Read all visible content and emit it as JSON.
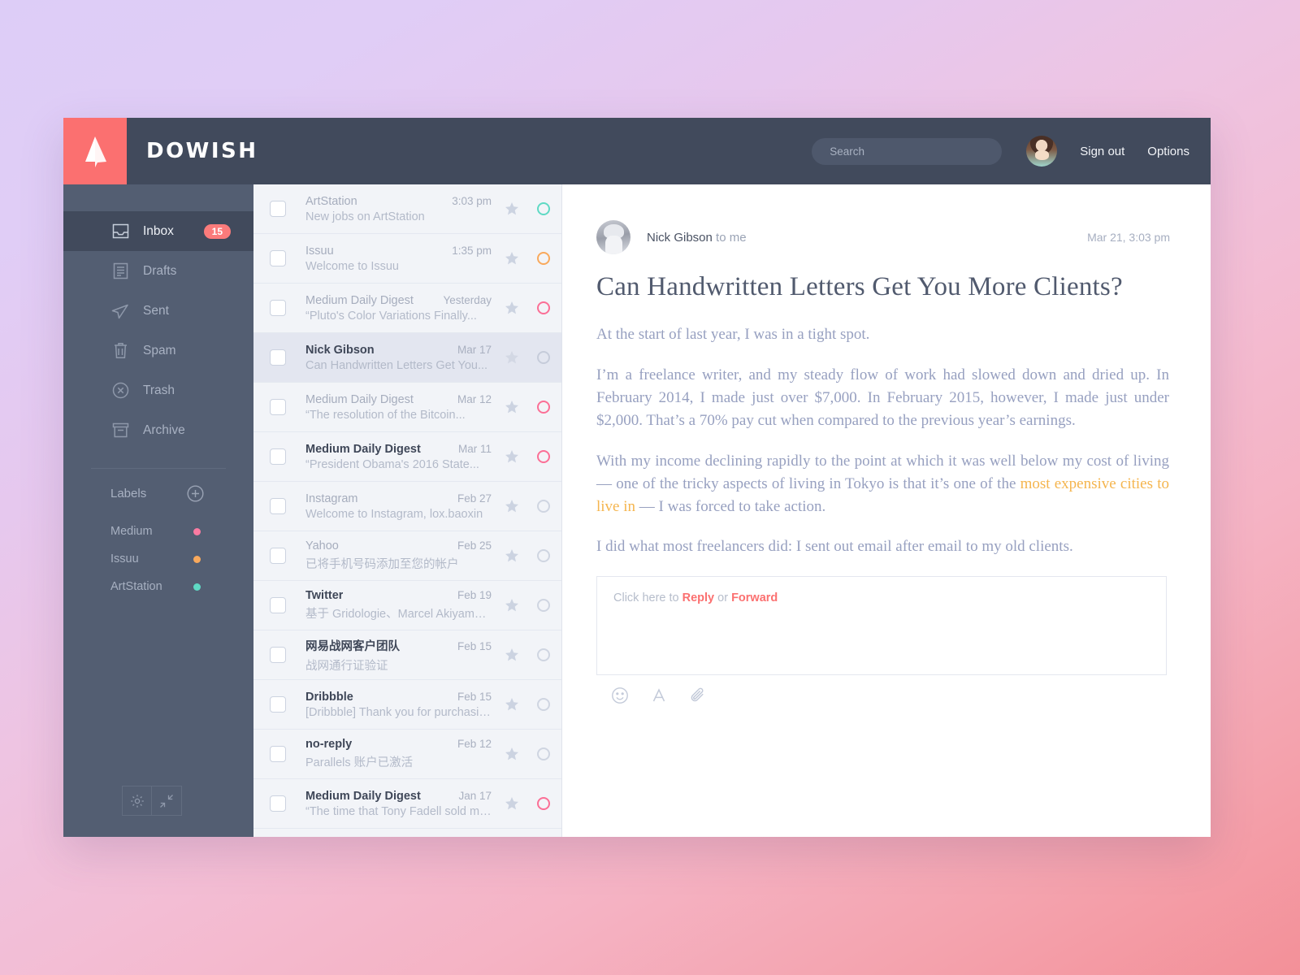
{
  "brand": {
    "name": "DOWISH",
    "logo_icon": "paper-plane-icon",
    "accent": "#fb7070"
  },
  "topbar": {
    "search_placeholder": "Search",
    "search_value": "",
    "sign_out": "Sign out",
    "options": "Options",
    "avatar_icon": "user-avatar"
  },
  "sidebar": {
    "items": [
      {
        "label": "Inbox",
        "icon": "inbox-icon",
        "badge": "15",
        "active": true
      },
      {
        "label": "Drafts",
        "icon": "drafts-icon",
        "badge": "",
        "active": false
      },
      {
        "label": "Sent",
        "icon": "sent-icon",
        "badge": "",
        "active": false
      },
      {
        "label": "Spam",
        "icon": "spam-icon",
        "badge": "",
        "active": false
      },
      {
        "label": "Trash",
        "icon": "trash-icon",
        "badge": "",
        "active": false
      },
      {
        "label": "Archive",
        "icon": "archive-icon",
        "badge": "",
        "active": false
      }
    ],
    "labels_title": "Labels",
    "add_label_icon": "plus-circle-icon",
    "labels": [
      {
        "name": "Medium",
        "color": "#fb7ba2"
      },
      {
        "name": "Issuu",
        "color": "#f9a95c"
      },
      {
        "name": "ArtStation",
        "color": "#5fd9c4"
      }
    ],
    "settings_icon": "gear-icon",
    "collapse_icon": "collapse-icon"
  },
  "maillist": [
    {
      "from": "ArtStation",
      "subject": "New jobs on ArtStation",
      "date": "3:03 pm",
      "dot": "#5fd9c4",
      "bold": false,
      "selected": false
    },
    {
      "from": "Issuu",
      "subject": "Welcome to Issuu",
      "date": "1:35 pm",
      "dot": "#f9a95c",
      "bold": false,
      "selected": false
    },
    {
      "from": "Medium Daily Digest",
      "subject": "“Pluto's Color Variations Finally...",
      "date": "Yesterday",
      "dot": "#fb6f96",
      "bold": false,
      "selected": false
    },
    {
      "from": "Nick Gibson",
      "subject": "Can Handwritten Letters Get You...",
      "date": "Mar 17",
      "dot": "#cfd5e1",
      "bold": true,
      "selected": true
    },
    {
      "from": "Medium Daily Digest",
      "subject": "“The resolution of the Bitcoin...",
      "date": "Mar 12",
      "dot": "#fb6f96",
      "bold": false,
      "selected": false
    },
    {
      "from": "Medium Daily Digest",
      "subject": "“President Obama's 2016 State...",
      "date": "Mar 11",
      "dot": "#fb6f96",
      "bold": true,
      "selected": false
    },
    {
      "from": "Instagram",
      "subject": "Welcome to Instagram, lox.baoxin",
      "date": "Feb 27",
      "dot": "#cfd5e1",
      "bold": false,
      "selected": false
    },
    {
      "from": "Yahoo",
      "subject": "已将手机号码添加至您的帐户",
      "date": "Feb 25",
      "dot": "#cfd5e1",
      "bold": false,
      "selected": false
    },
    {
      "from": "Twitter",
      "subject": "基于 Gridologie、Marcel Akiyama 和...",
      "date": "Feb 19",
      "dot": "#cfd5e1",
      "bold": true,
      "selected": false
    },
    {
      "from": "网易战网客户团队",
      "subject": "战网通行证验证",
      "date": "Feb 15",
      "dot": "#cfd5e1",
      "bold": true,
      "selected": false
    },
    {
      "from": "Dribbble",
      "subject": "[Dribbble] Thank you for purchasing...",
      "date": "Feb 15",
      "dot": "#cfd5e1",
      "bold": true,
      "selected": false
    },
    {
      "from": "no-reply",
      "subject": "Parallels 账户已激活",
      "date": "Feb 12",
      "dot": "#cfd5e1",
      "bold": true,
      "selected": false
    },
    {
      "from": "Medium Daily Digest",
      "subject": "“The time that Tony Fadell sold me a...",
      "date": "Jan 17",
      "dot": "#fb6f96",
      "bold": true,
      "selected": false
    }
  ],
  "message": {
    "sender": "Nick Gibson",
    "recipient": "to me",
    "date": "Mar 21, 3:03 pm",
    "title": "Can Handwritten Letters Get You More Clients?",
    "p1": "At the start of last year, I was in a tight spot.",
    "p2": "I’m a freelance writer, and my steady flow of work had slowed down and dried up. In February 2014, I made just over $7,000. In February 2015, however, I made just under $2,000. That’s a 70% pay cut when compared to the previous year’s earnings.",
    "p3a": "With my income declining rapidly to the point at which it was well below my cost of living — one of the tricky aspects of living in Tokyo is that it’s one of the ",
    "p3_link": "most expensive cities to live in",
    "p3b": " — I was forced to take action.",
    "p4": "I did what most freelancers did: I sent out email after email to my old clients."
  },
  "reply": {
    "prefix": "Click here to ",
    "reply_label": "Reply",
    "middle": " or ",
    "forward_label": "Forward",
    "emoji_icon": "emoji-icon",
    "format_icon": "text-format-icon",
    "attach_icon": "paperclip-icon"
  }
}
